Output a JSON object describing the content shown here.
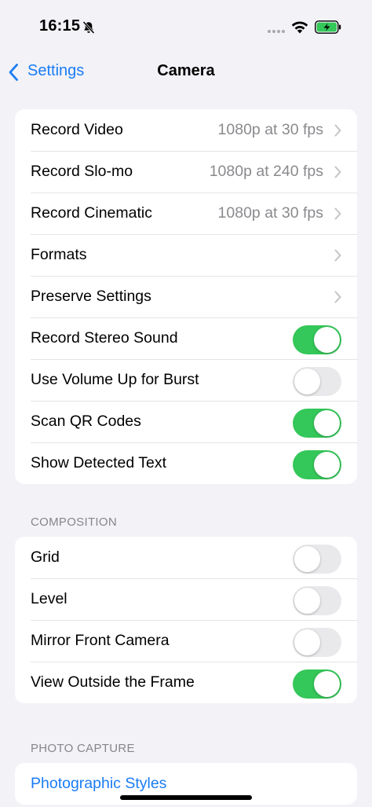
{
  "status_bar": {
    "time": "16:15"
  },
  "nav": {
    "back_label": "Settings",
    "title": "Camera"
  },
  "main_rows": [
    {
      "label": "Record Video",
      "value": "1080p at 30 fps"
    },
    {
      "label": "Record Slo-mo",
      "value": "1080p at 240 fps"
    },
    {
      "label": "Record Cinematic",
      "value": "1080p at 30 fps"
    },
    {
      "label": "Formats"
    },
    {
      "label": "Preserve Settings"
    },
    {
      "label": "Record Stereo Sound",
      "toggle": true
    },
    {
      "label": "Use Volume Up for Burst",
      "toggle": false
    },
    {
      "label": "Scan QR Codes",
      "toggle": true
    },
    {
      "label": "Show Detected Text",
      "toggle": true
    }
  ],
  "composition": {
    "header": "COMPOSITION",
    "rows": [
      {
        "label": "Grid",
        "toggle": false
      },
      {
        "label": "Level",
        "toggle": false
      },
      {
        "label": "Mirror Front Camera",
        "toggle": false
      },
      {
        "label": "View Outside the Frame",
        "toggle": true
      }
    ]
  },
  "photo_capture": {
    "header": "PHOTO CAPTURE",
    "rows": [
      {
        "label": "Photographic Styles"
      }
    ]
  },
  "colors": {
    "accent": "#1a7cf5",
    "toggle_on": "#34c759",
    "toggle_off": "#e9e9eb",
    "background": "#f2f2f7"
  },
  "icons": [
    "bell-slash-icon",
    "wifi-icon",
    "battery-charging-icon",
    "chevron-left-icon",
    "chevron-right-icon"
  ]
}
